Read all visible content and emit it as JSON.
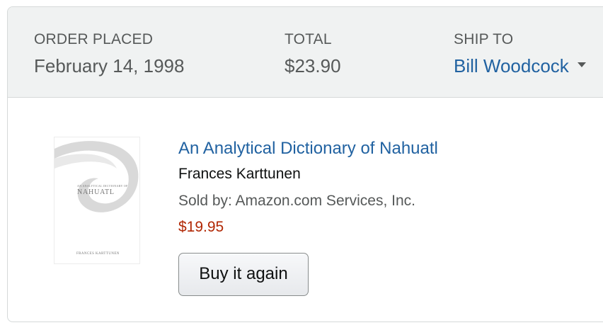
{
  "order": {
    "placed_label": "ORDER PLACED",
    "placed_value": "February 14, 1998",
    "total_label": "TOTAL",
    "total_value": "$23.90",
    "ship_to_label": "SHIP TO",
    "ship_to_value": "Bill Woodcock"
  },
  "item": {
    "title": "An Analytical Dictionary of Nahuatl",
    "author": "Frances Karttunen",
    "seller": "Sold by: Amazon.com Services, Inc.",
    "price": "$19.95",
    "buy_again_label": "Buy it again",
    "cover": {
      "subtitle": "AN ANALYTICAL DICTIONARY OF",
      "title": "NAHUATL",
      "author": "FRANCES KARTTUNEN"
    }
  },
  "colors": {
    "link": "#2162a1",
    "price": "#b12704",
    "header_bg": "#f0f2f2"
  },
  "icons": {
    "ship_to_dropdown": "caret-down-icon"
  }
}
